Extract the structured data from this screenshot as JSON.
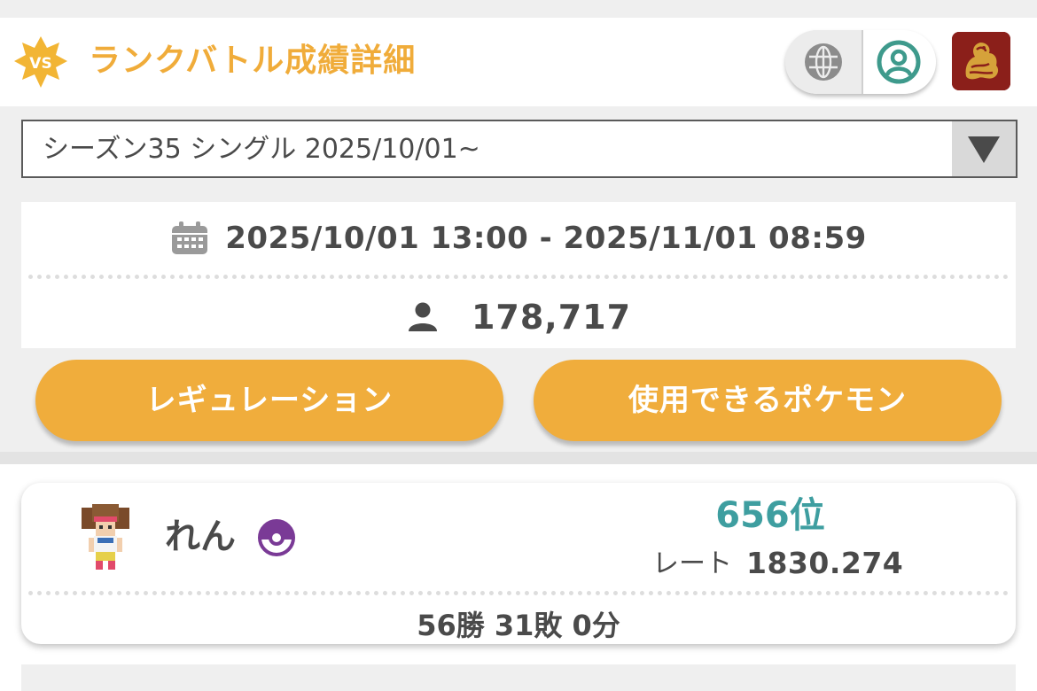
{
  "header": {
    "badge_text": "VS",
    "title": "ランクバトル成績詳細"
  },
  "season_select": {
    "selected": "シーズン35 シングル 2025/10/01~"
  },
  "season_info": {
    "period": "2025/10/01 13:00 - 2025/11/01 08:59",
    "players": "178,717"
  },
  "buttons": {
    "regulation": "レギュレーション",
    "usable_pokemon": "使用できるポケモン"
  },
  "player": {
    "name": "れん",
    "rank": "656位",
    "rate_label": "レート",
    "rate_value": "1830.274",
    "record": "56勝 31敗 0分"
  },
  "icons": [
    "vs-badge-icon",
    "globe-icon",
    "user-circle-icon",
    "app-emblem-icon",
    "dropdown-arrow-icon",
    "calendar-icon",
    "person-icon",
    "trainer-sprite-icon",
    "poke-ball-icon"
  ],
  "colors": {
    "accent": "#f0ac3a",
    "rank": "#3e9ea0",
    "toggle_active": "#3e9a8c",
    "ball": "#7a3a96"
  }
}
